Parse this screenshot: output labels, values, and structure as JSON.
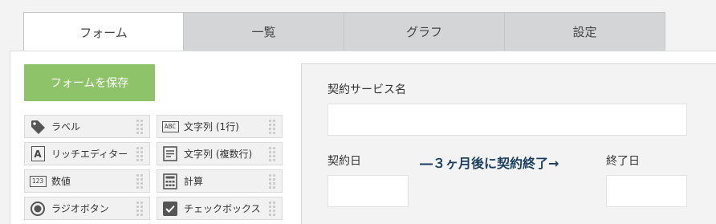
{
  "tabs": [
    {
      "label": "フォーム",
      "active": true
    },
    {
      "label": "一覧",
      "active": false
    },
    {
      "label": "グラフ",
      "active": false
    },
    {
      "label": "設定",
      "active": false
    }
  ],
  "save_button": {
    "label": "フォームを保存",
    "color": "#8fc369"
  },
  "palette": [
    {
      "label": "ラベル",
      "icon": "tag-icon"
    },
    {
      "label": "文字列 (1行)",
      "icon": "abc-text-icon"
    },
    {
      "label": "リッチエディター",
      "icon": "rich-editor-icon"
    },
    {
      "label": "文字列 (複数行)",
      "icon": "multiline-text-icon"
    },
    {
      "label": "数値",
      "icon": "number-icon"
    },
    {
      "label": "計算",
      "icon": "calculator-icon"
    },
    {
      "label": "ラジオボタン",
      "icon": "radio-button-icon"
    },
    {
      "label": "チェックボックス",
      "icon": "checkbox-icon"
    }
  ],
  "form": {
    "service_name_label": "契約サービス名",
    "service_name_value": "",
    "contract_date_label": "契約日",
    "contract_date_value": "",
    "note": "―３ヶ月後に契約終了→",
    "end_date_label": "終了日",
    "end_date_value": ""
  },
  "colors": {
    "accent": "#8fc369",
    "note_text": "#1c3f5f",
    "tab_inactive": "#d3d5d6"
  }
}
